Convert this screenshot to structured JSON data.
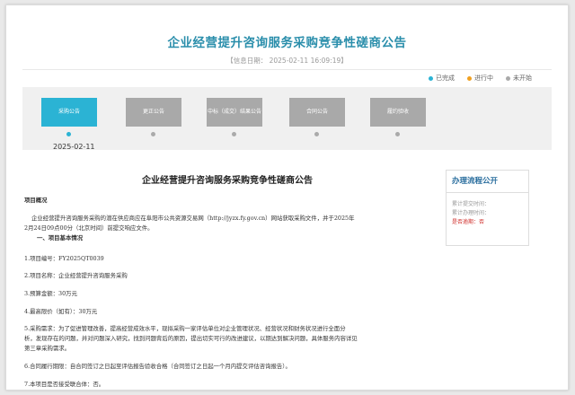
{
  "header": {
    "title": "企业经营提升咨询服务采购竞争性磋商公告",
    "info_date": "【信息日期： 2025-02-11 16:09:19】"
  },
  "legend": [
    {
      "label": "已完成",
      "color": "#2bb3d4"
    },
    {
      "label": "进行中",
      "color": "#f0a020"
    },
    {
      "label": "未开始",
      "color": "#aaaaaa"
    }
  ],
  "process": {
    "steps": [
      {
        "label": "采购公告",
        "status": "done"
      },
      {
        "label": "更正公告",
        "status": "pending"
      },
      {
        "label": "中标（成交）结果公告",
        "status": "pending"
      },
      {
        "label": "合同公告",
        "status": "pending"
      },
      {
        "label": "履约验收",
        "status": "pending"
      }
    ],
    "active_date": "2025-02-11"
  },
  "document": {
    "title": "企业经营提升咨询服务采购竞争性磋商公告",
    "overview_heading": "项目概况",
    "overview_text_1": "企业经营提升咨询服务采购的潜在供应商应在阜阳市公共资源交易网（http://jyzx.fy.gov.cn）网站获取采购文件，并于2025年",
    "overview_text_2": "2月24日09点00分（北京时间）前提交响应文件。",
    "section1_heading": "一、项目基本情况",
    "item1": "1.项目编号：FY2025QT0039",
    "item2": "2.项目名称：企业经营提升咨询服务采购",
    "item3": "3.预算金额：30万元",
    "item4": "4.最高限价（如有）：30万元",
    "item5_line1": "5.采购需求：为了促进管理改善，提高经营成效水平，现拟采购一家评估单位对企业管理状况、经营状况和财务状况进行全面分",
    "item5_line2": "析，发现存在的问题，并对问题深入研究，找到问题背后的原因，提出切实可行的改进建议，以期达到解决问题，具体服务内容详见",
    "item5_line3": "第三章采购需求。",
    "item6": "6.合同履行期限：自合同签订之日起至评估报告验收合格（合同签订之日起一个月内提交评估咨询报告）。",
    "item7": "7.本项目是否接受联合体：否。"
  },
  "sidebar": {
    "title": "办理流程公开",
    "line1": "累计提交时间：",
    "line2": "累计办理时间：",
    "line3": "是否逾期：否"
  }
}
